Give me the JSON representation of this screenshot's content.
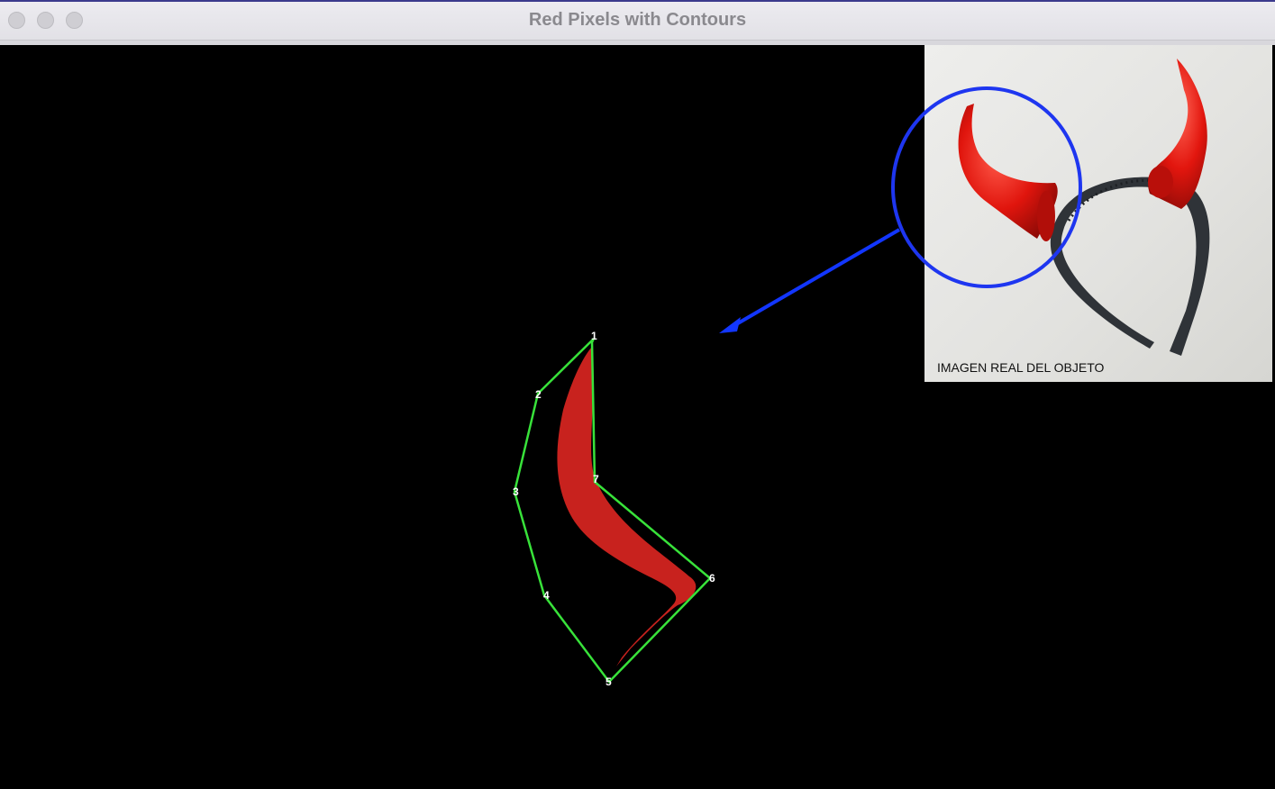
{
  "window": {
    "title": "Red Pixels with Contours"
  },
  "photo": {
    "caption": "IMAGEN REAL DEL OBJETO"
  },
  "contour": {
    "vertex_labels": [
      "1",
      "2",
      "3",
      "4",
      "5",
      "6",
      "7"
    ],
    "line_color": "#38e23a",
    "fill_color": "#c8221e"
  },
  "annotation": {
    "circle_color": "#1e36f0",
    "arrow_color": "#1236ff"
  },
  "icons": {
    "close": "close-icon",
    "minimize": "minimize-icon",
    "zoom": "zoom-icon"
  }
}
